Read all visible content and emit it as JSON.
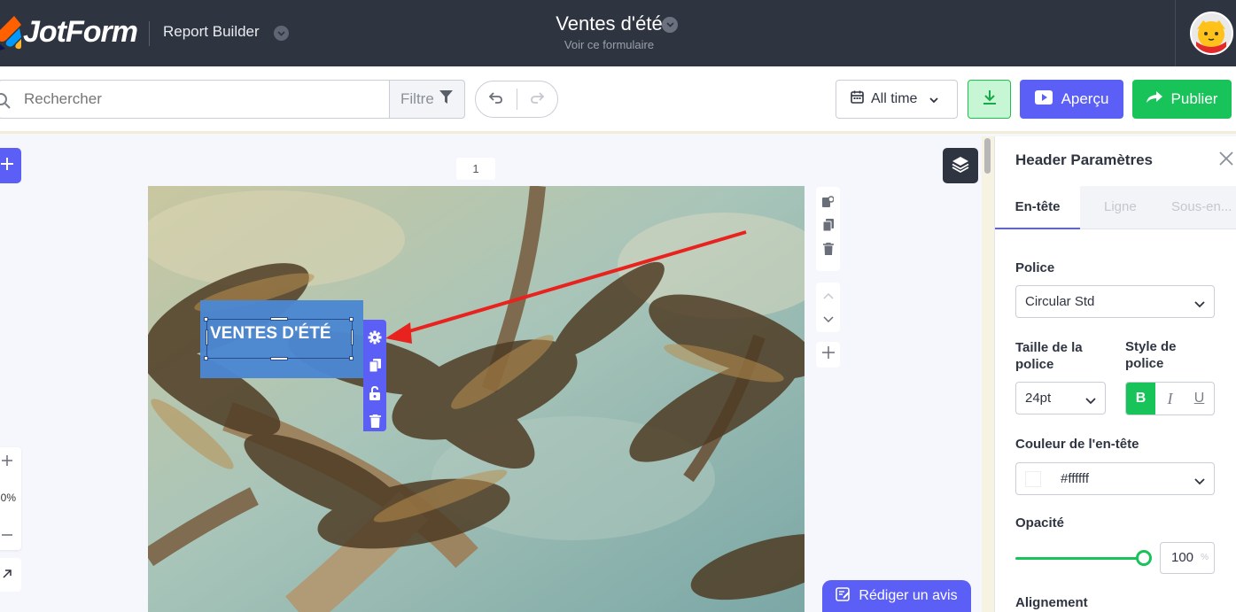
{
  "topbar": {
    "logo_text": "JotForm",
    "app_name": "Report Builder",
    "form_title": "Ventes d'été",
    "form_subtitle": "Voir ce formulaire"
  },
  "toolbar": {
    "search_placeholder": "Rechercher",
    "filter_label": "Filtre",
    "time_range": "All time",
    "preview_label": "Aperçu",
    "publish_label": "Publier"
  },
  "canvas": {
    "page_number": "1",
    "header_text": "VENTES D'ÉTÉ",
    "zoom_level": "0%",
    "review_label": "Rédiger un avis"
  },
  "panel": {
    "title": "Header Paramètres",
    "tabs": [
      {
        "label": "En-tête",
        "active": true
      },
      {
        "label": "Ligne",
        "active": false
      },
      {
        "label": "Sous-en...",
        "active": false
      }
    ],
    "font_label": "Police",
    "font_value": "Circular Std",
    "font_size_label": "Taille de la police",
    "font_size_value": "24pt",
    "font_style_label": "Style de police",
    "style_bold": "B",
    "style_italic": "I",
    "style_underline": "U",
    "color_label": "Couleur de l'en-tête",
    "color_value": "#ffffff",
    "opacity_label": "Opacité",
    "opacity_value": "100",
    "opacity_unit": "%",
    "opacity_level": 1.0,
    "alignment_label": "Alignement"
  },
  "colors": {
    "topbar_bg": "#2f3441",
    "accent_purple": "#5b5ff5",
    "accent_green": "#18c35a",
    "header_box": "#4b87d1",
    "annotation_arrow": "#e8231f"
  },
  "icons": {
    "search": "search-icon",
    "filter": "funnel-icon",
    "undo": "undo-icon",
    "redo": "redo-icon",
    "calendar": "calendar-icon",
    "download": "download-icon",
    "preview": "play-icon",
    "publish": "share-arrow-icon",
    "layers": "layers-icon",
    "settings": "gear-icon",
    "copy": "copy-icon",
    "lock": "unlock-icon",
    "delete": "trash-icon"
  }
}
